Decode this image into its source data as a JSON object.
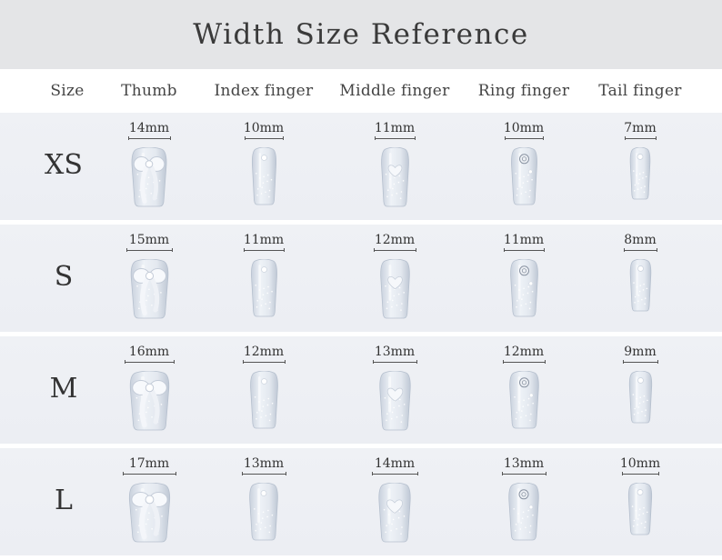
{
  "title": "Width Size Reference",
  "headers": {
    "size": "Size",
    "thumb": "Thumb",
    "index": "Index finger",
    "middle": "Middle finger",
    "ring": "Ring finger",
    "tail": "Tail finger"
  },
  "rows": [
    {
      "size": "XS",
      "thumb": "14mm",
      "index": "10mm",
      "middle": "11mm",
      "ring": "10mm",
      "tail": "7mm"
    },
    {
      "size": "S",
      "thumb": "15mm",
      "index": "11mm",
      "middle": "12mm",
      "ring": "11mm",
      "tail": "8mm"
    },
    {
      "size": "M",
      "thumb": "16mm",
      "index": "12mm",
      "middle": "13mm",
      "ring": "12mm",
      "tail": "9mm"
    },
    {
      "size": "L",
      "thumb": "17mm",
      "index": "13mm",
      "middle": "14mm",
      "ring": "13mm",
      "tail": "10mm"
    }
  ],
  "nail_images": {
    "thumb": "bow-press-on-nail",
    "index": "pearl-glitter-press-on-nail",
    "middle": "heart-press-on-nail",
    "ring": "rose-charm-press-on-nail",
    "tail": "pearl-press-on-nail"
  },
  "colors": {
    "title_bar": "#e4e5e7",
    "row_background": "#eff1f5",
    "nail_base": "#dde3ec"
  }
}
